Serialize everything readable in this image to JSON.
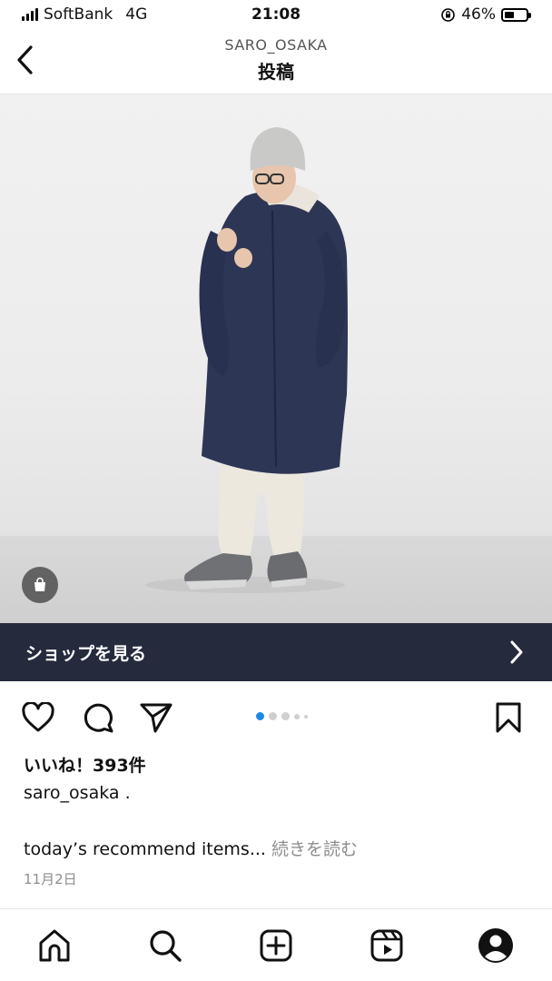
{
  "status_bar": {
    "carrier": "SoftBank",
    "network": "4G",
    "time": "21:08",
    "battery": "46%",
    "battery_level": 0.46
  },
  "header": {
    "account": "SARO_OSAKA",
    "title": "投稿"
  },
  "shop_bar": {
    "label": "ショップを見る"
  },
  "post": {
    "likes": "いいね！393件",
    "username": "saro_osaka .",
    "caption": "today’s recommend items...",
    "read_more": "続きを読む",
    "date": "11月2日",
    "carousel_active_index": 0
  },
  "icons": {
    "back": "chevron-left-icon",
    "shop_tag": "shopping-bag-icon",
    "like": "heart-icon",
    "comment": "comment-icon",
    "share": "send-icon",
    "save": "bookmark-icon",
    "tabs": [
      "home-icon",
      "search-icon",
      "new-post-icon",
      "reels-icon",
      "profile-icon"
    ]
  },
  "colors": {
    "shop_bar_bg": "#262a3d",
    "carousel_active": "#1e88e5",
    "muted_text": "#8e8e8e"
  }
}
